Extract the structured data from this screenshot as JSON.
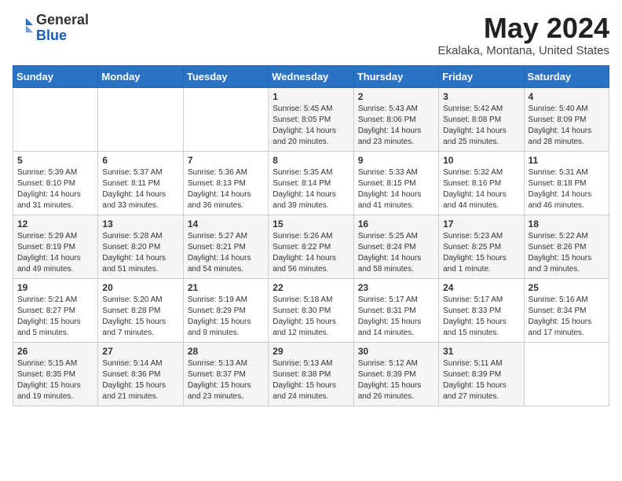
{
  "header": {
    "logo_general": "General",
    "logo_blue": "Blue",
    "month_title": "May 2024",
    "location": "Ekalaka, Montana, United States"
  },
  "weekdays": [
    "Sunday",
    "Monday",
    "Tuesday",
    "Wednesday",
    "Thursday",
    "Friday",
    "Saturday"
  ],
  "weeks": [
    [
      {
        "day": "",
        "info": ""
      },
      {
        "day": "",
        "info": ""
      },
      {
        "day": "",
        "info": ""
      },
      {
        "day": "1",
        "info": "Sunrise: 5:45 AM\nSunset: 8:05 PM\nDaylight: 14 hours\nand 20 minutes."
      },
      {
        "day": "2",
        "info": "Sunrise: 5:43 AM\nSunset: 8:06 PM\nDaylight: 14 hours\nand 23 minutes."
      },
      {
        "day": "3",
        "info": "Sunrise: 5:42 AM\nSunset: 8:08 PM\nDaylight: 14 hours\nand 25 minutes."
      },
      {
        "day": "4",
        "info": "Sunrise: 5:40 AM\nSunset: 8:09 PM\nDaylight: 14 hours\nand 28 minutes."
      }
    ],
    [
      {
        "day": "5",
        "info": "Sunrise: 5:39 AM\nSunset: 8:10 PM\nDaylight: 14 hours\nand 31 minutes."
      },
      {
        "day": "6",
        "info": "Sunrise: 5:37 AM\nSunset: 8:11 PM\nDaylight: 14 hours\nand 33 minutes."
      },
      {
        "day": "7",
        "info": "Sunrise: 5:36 AM\nSunset: 8:13 PM\nDaylight: 14 hours\nand 36 minutes."
      },
      {
        "day": "8",
        "info": "Sunrise: 5:35 AM\nSunset: 8:14 PM\nDaylight: 14 hours\nand 39 minutes."
      },
      {
        "day": "9",
        "info": "Sunrise: 5:33 AM\nSunset: 8:15 PM\nDaylight: 14 hours\nand 41 minutes."
      },
      {
        "day": "10",
        "info": "Sunrise: 5:32 AM\nSunset: 8:16 PM\nDaylight: 14 hours\nand 44 minutes."
      },
      {
        "day": "11",
        "info": "Sunrise: 5:31 AM\nSunset: 8:18 PM\nDaylight: 14 hours\nand 46 minutes."
      }
    ],
    [
      {
        "day": "12",
        "info": "Sunrise: 5:29 AM\nSunset: 8:19 PM\nDaylight: 14 hours\nand 49 minutes."
      },
      {
        "day": "13",
        "info": "Sunrise: 5:28 AM\nSunset: 8:20 PM\nDaylight: 14 hours\nand 51 minutes."
      },
      {
        "day": "14",
        "info": "Sunrise: 5:27 AM\nSunset: 8:21 PM\nDaylight: 14 hours\nand 54 minutes."
      },
      {
        "day": "15",
        "info": "Sunrise: 5:26 AM\nSunset: 8:22 PM\nDaylight: 14 hours\nand 56 minutes."
      },
      {
        "day": "16",
        "info": "Sunrise: 5:25 AM\nSunset: 8:24 PM\nDaylight: 14 hours\nand 58 minutes."
      },
      {
        "day": "17",
        "info": "Sunrise: 5:23 AM\nSunset: 8:25 PM\nDaylight: 15 hours\nand 1 minute."
      },
      {
        "day": "18",
        "info": "Sunrise: 5:22 AM\nSunset: 8:26 PM\nDaylight: 15 hours\nand 3 minutes."
      }
    ],
    [
      {
        "day": "19",
        "info": "Sunrise: 5:21 AM\nSunset: 8:27 PM\nDaylight: 15 hours\nand 5 minutes."
      },
      {
        "day": "20",
        "info": "Sunrise: 5:20 AM\nSunset: 8:28 PM\nDaylight: 15 hours\nand 7 minutes."
      },
      {
        "day": "21",
        "info": "Sunrise: 5:19 AM\nSunset: 8:29 PM\nDaylight: 15 hours\nand 9 minutes."
      },
      {
        "day": "22",
        "info": "Sunrise: 5:18 AM\nSunset: 8:30 PM\nDaylight: 15 hours\nand 12 minutes."
      },
      {
        "day": "23",
        "info": "Sunrise: 5:17 AM\nSunset: 8:31 PM\nDaylight: 15 hours\nand 14 minutes."
      },
      {
        "day": "24",
        "info": "Sunrise: 5:17 AM\nSunset: 8:33 PM\nDaylight: 15 hours\nand 15 minutes."
      },
      {
        "day": "25",
        "info": "Sunrise: 5:16 AM\nSunset: 8:34 PM\nDaylight: 15 hours\nand 17 minutes."
      }
    ],
    [
      {
        "day": "26",
        "info": "Sunrise: 5:15 AM\nSunset: 8:35 PM\nDaylight: 15 hours\nand 19 minutes."
      },
      {
        "day": "27",
        "info": "Sunrise: 5:14 AM\nSunset: 8:36 PM\nDaylight: 15 hours\nand 21 minutes."
      },
      {
        "day": "28",
        "info": "Sunrise: 5:13 AM\nSunset: 8:37 PM\nDaylight: 15 hours\nand 23 minutes."
      },
      {
        "day": "29",
        "info": "Sunrise: 5:13 AM\nSunset: 8:38 PM\nDaylight: 15 hours\nand 24 minutes."
      },
      {
        "day": "30",
        "info": "Sunrise: 5:12 AM\nSunset: 8:39 PM\nDaylight: 15 hours\nand 26 minutes."
      },
      {
        "day": "31",
        "info": "Sunrise: 5:11 AM\nSunset: 8:39 PM\nDaylight: 15 hours\nand 27 minutes."
      },
      {
        "day": "",
        "info": ""
      }
    ]
  ]
}
